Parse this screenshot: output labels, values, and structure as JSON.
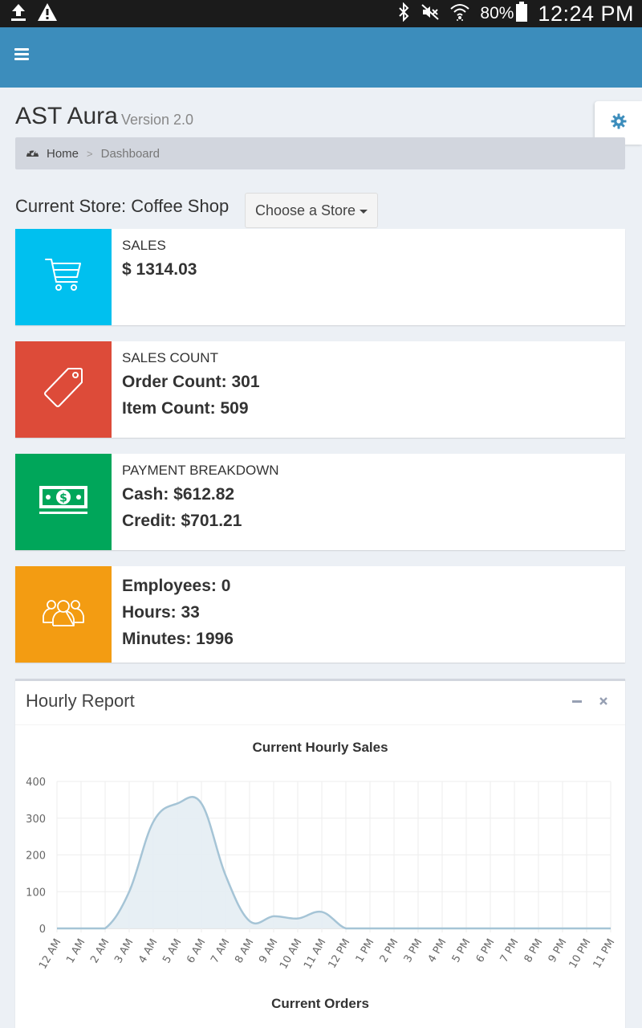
{
  "status_bar": {
    "battery": "80%",
    "time": "12:24 PM",
    "icons": [
      "upload-icon",
      "warning-icon",
      "bluetooth-icon",
      "mute-icon",
      "wifi-icon",
      "battery-icon"
    ]
  },
  "header": {
    "menu_icon": "hamburger-menu-icon",
    "accent": "#3c8dbc"
  },
  "page": {
    "title": "AST Aura",
    "version": "Version 2.0",
    "settings_icon": "gear-icon"
  },
  "breadcrumb": {
    "home": "Home",
    "separator": ">",
    "current": "Dashboard"
  },
  "store": {
    "current_label": "Current Store: Coffee Shop",
    "choose_button": "Choose a Store"
  },
  "info_boxes": {
    "sales": {
      "label": "SALES",
      "value": "$ 1314.03",
      "color": "#00c0ef",
      "icon": "cart-icon"
    },
    "sales_count": {
      "label": "SALES COUNT",
      "order_count": "Order Count: 301",
      "item_count": "Item Count: 509",
      "color": "#dd4b39",
      "icon": "tag-icon"
    },
    "payment": {
      "label": "PAYMENT BREAKDOWN",
      "cash": "Cash: $612.82",
      "credit": "Credit: $701.21",
      "color": "#00a65a",
      "icon": "money-icon"
    },
    "employees": {
      "employees": "Employees: 0",
      "hours": "Hours: 33",
      "minutes": "Minutes: 1996",
      "color": "#f39c12",
      "icon": "users-icon"
    }
  },
  "report": {
    "title": "Hourly Report",
    "collapse_icon": "minus-icon",
    "close_icon": "close-icon",
    "second_chart_title": "Current Orders"
  },
  "chart_data": {
    "type": "area",
    "title": "Current Hourly Sales",
    "xlabel": "",
    "ylabel": "",
    "categories": [
      "12 AM",
      "1 AM",
      "2 AM",
      "3 AM",
      "4 AM",
      "5 AM",
      "6 AM",
      "7 AM",
      "8 AM",
      "9 AM",
      "10 AM",
      "11 AM",
      "12 PM",
      "1 PM",
      "2 PM",
      "3 PM",
      "4 PM",
      "5 PM",
      "6 PM",
      "7 PM",
      "8 PM",
      "9 PM",
      "10 PM",
      "11 PM"
    ],
    "values": [
      0,
      0,
      0,
      100,
      290,
      340,
      340,
      145,
      20,
      33,
      27,
      45,
      0,
      0,
      0,
      0,
      0,
      0,
      0,
      0,
      0,
      0,
      0,
      0
    ],
    "ylim": [
      0,
      400
    ],
    "yticks": [
      "400",
      "300",
      "200",
      "100",
      "0"
    ],
    "grid": true,
    "line_color": "#a5c4d6",
    "fill_color": "#e4edf3"
  }
}
